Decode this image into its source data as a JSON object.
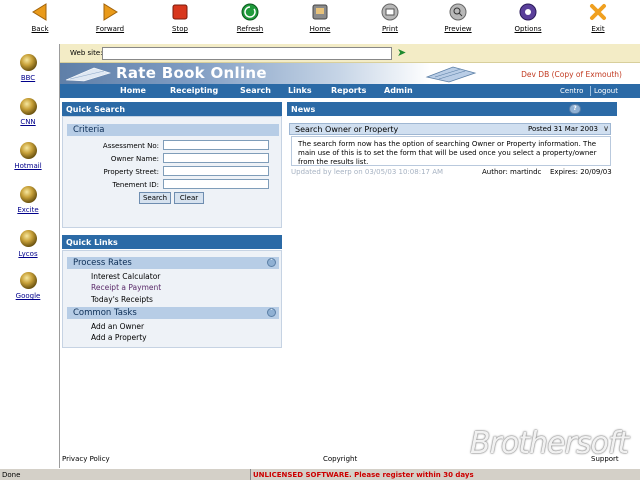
{
  "toolbar": {
    "buttons": [
      {
        "label": "Back",
        "icon": "arrow-left-icon"
      },
      {
        "label": "Forward",
        "icon": "arrow-right-icon"
      },
      {
        "label": "Stop",
        "icon": "stop-icon"
      },
      {
        "label": "Refresh",
        "icon": "refresh-icon"
      },
      {
        "label": "Home",
        "icon": "home-icon"
      },
      {
        "label": "Print",
        "icon": "print-icon"
      },
      {
        "label": "Preview",
        "icon": "preview-icon"
      },
      {
        "label": "Options",
        "icon": "options-icon"
      },
      {
        "label": "Exit",
        "icon": "exit-icon"
      }
    ]
  },
  "favorites": [
    {
      "label": "BBC"
    },
    {
      "label": "CNN"
    },
    {
      "label": "Hotmail"
    },
    {
      "label": "Excite"
    },
    {
      "label": "Lycos"
    },
    {
      "label": "Google"
    }
  ],
  "address": {
    "label": "Web site:",
    "value": ""
  },
  "banner": {
    "title": "Rate Book Online",
    "user": "Dev DB (Copy of Exmouth)"
  },
  "nav": {
    "items": [
      "Home",
      "Receipting",
      "Search",
      "Links",
      "Reports",
      "Admin"
    ],
    "right": [
      "Centro",
      "Logout"
    ]
  },
  "quick_search": {
    "title": "Quick Search",
    "criteria": "Criteria",
    "fields": [
      {
        "label": "Assessment No:",
        "value": ""
      },
      {
        "label": "Owner Name:",
        "value": ""
      },
      {
        "label": "Property Street:",
        "value": ""
      },
      {
        "label": "Tenement ID:",
        "value": ""
      }
    ],
    "search_label": "Search",
    "clear_label": "Clear"
  },
  "quick_links": {
    "title": "Quick Links",
    "groups": [
      {
        "title": "Process Rates",
        "items": [
          "Interest Calculator",
          "Receipt a Payment",
          "Today's Receipts"
        ]
      },
      {
        "title": "Common Tasks",
        "items": [
          "Add an Owner",
          "Add a Property"
        ]
      }
    ]
  },
  "news": {
    "title": "News",
    "item": {
      "title": "Search Owner or Property",
      "posted": "Posted 31 Mar 2003",
      "body": "The search form now has the option of searching Owner or Property information. The main use of this is to set the form that will be used once you select a property/owner from the results list.",
      "updated": "Updated by leerp on 03/05/03 10:08:17 AM",
      "author_label": "Author:",
      "author": "martindc",
      "expires": "Expires: 20/09/03"
    }
  },
  "footer": {
    "privacy": "Privacy Policy",
    "copyright": "Copyright",
    "support": "Support"
  },
  "status": {
    "left": "Done",
    "message": "UNLICENSED SOFTWARE. Please register within 30 days"
  },
  "watermark": "Brothersoft",
  "colors": {
    "nav": "#2b6aa6",
    "accent_red": "#c23b22",
    "address_bg": "#f3ecc6"
  }
}
